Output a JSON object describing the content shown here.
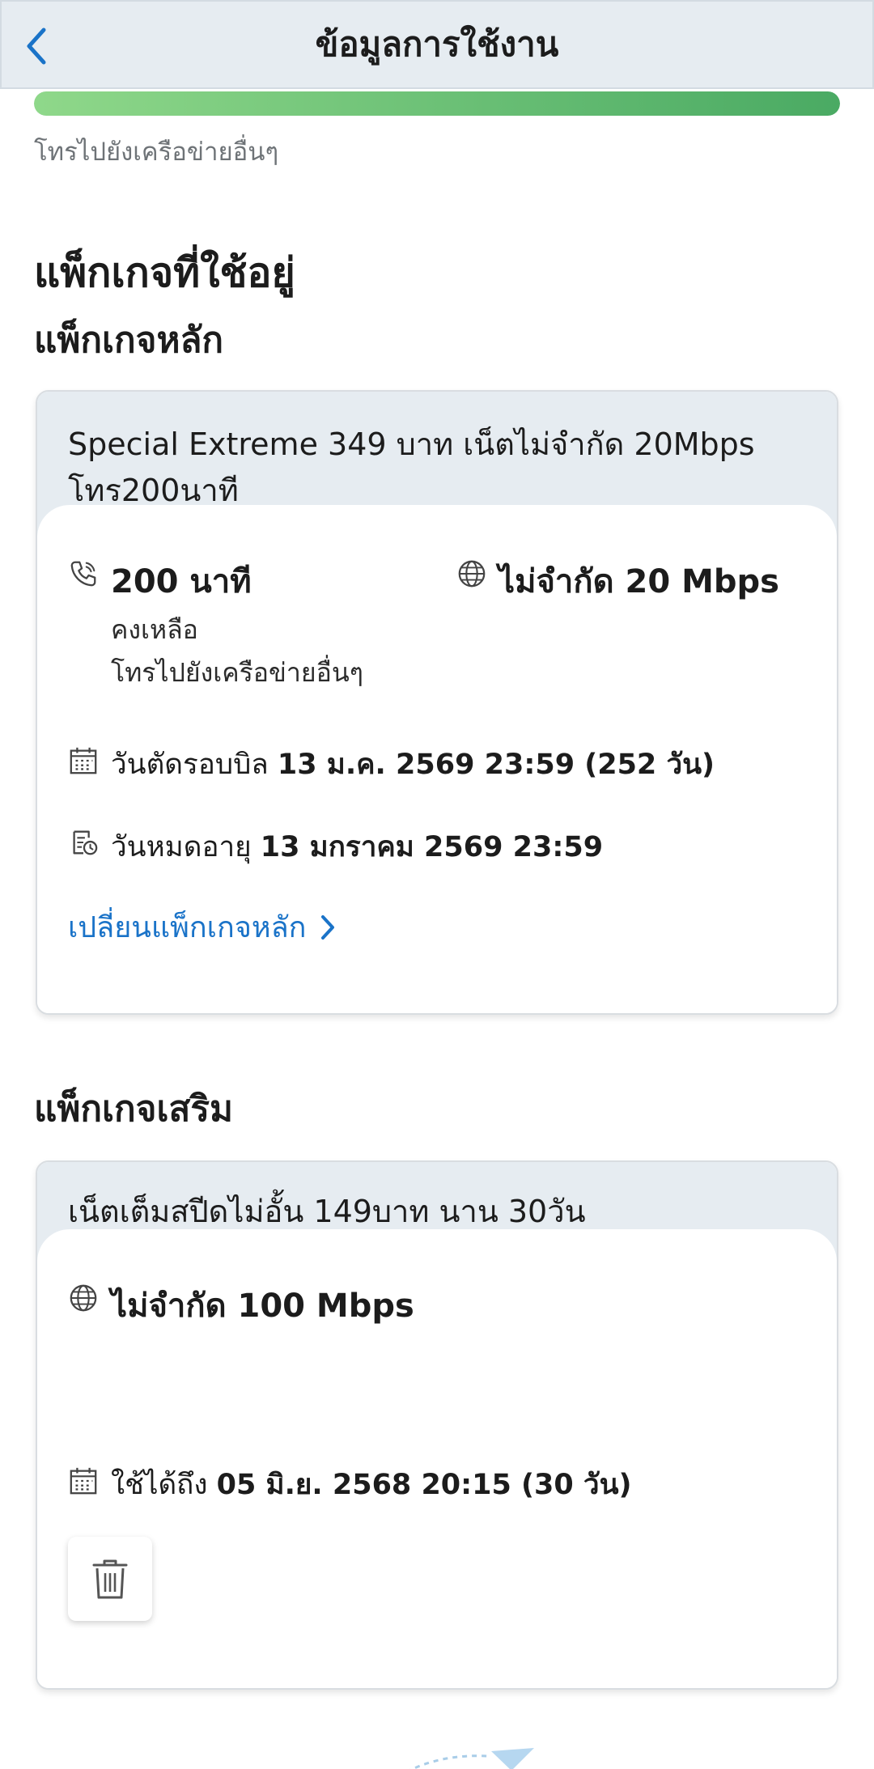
{
  "header": {
    "title": "ข้อมูลการใช้งาน"
  },
  "usage": {
    "progress_fraction": 1.0,
    "caption": "โทรไปยังเครือข่ายอื่นๆ"
  },
  "sections": {
    "used_packages": "แพ็กเกจที่ใช้อยู่",
    "main_package": "แพ็กเกจหลัก",
    "addon_package": "แพ็กเกจเสริม"
  },
  "main_card": {
    "name_line1": "Special Extreme 349 บาท เน็ตไม่จำกัด 20Mbps",
    "name_line2": "โทร200นาที",
    "call_value": "200 นาที",
    "call_remaining_label": "คงเหลือ",
    "call_remaining_desc": "โทรไปยังเครือข่ายอื่นๆ",
    "internet_value": "ไม่จำกัด 20 Mbps",
    "billing_label": "วันตัดรอบบิล",
    "billing_value": "13 ม.ค. 2569 23:59 (252 วัน)",
    "expiry_label": "วันหมดอายุ",
    "expiry_value": "13 มกราคม 2569 23:59",
    "change_link": "เปลี่ยนแพ็กเกจหลัก"
  },
  "addon_card": {
    "name": "เน็ตเต็มสปีดไม่อั้น 149บาท นาน 30วัน",
    "internet_value": "ไม่จำกัด 100 Mbps",
    "valid_label": "ใช้ได้ถึง",
    "valid_value": "05 มิ.ย. 2568 20:15 (30 วัน)"
  },
  "colors": {
    "header_bg": "#e6ecf1",
    "progress_start": "#8fd88a",
    "progress_end": "#4aaa63",
    "link": "#1a73c8",
    "back_arrow": "#1a73c8"
  },
  "icons": [
    "chevron-left-icon",
    "phone-icon",
    "globe-icon",
    "calendar-icon",
    "expiry-doc-icon",
    "chevron-right-icon",
    "trash-icon"
  ]
}
